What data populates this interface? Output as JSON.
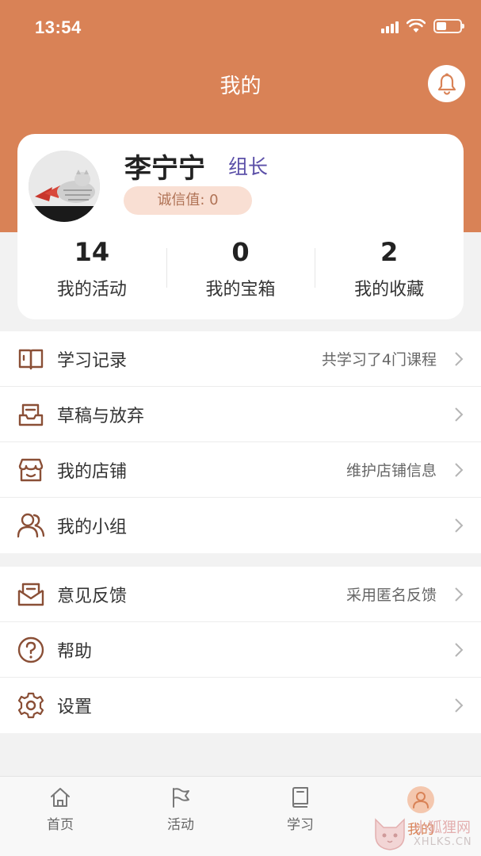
{
  "status_bar": {
    "time": "13:54"
  },
  "header": {
    "title": "我的",
    "bell_icon": "bell-icon"
  },
  "profile": {
    "name": "李宁宁",
    "role": "组长",
    "credit": "诚信值: 0",
    "stats": [
      {
        "value": "14",
        "label": "我的活动"
      },
      {
        "value": "0",
        "label": "我的宝箱"
      },
      {
        "value": "2",
        "label": "我的收藏"
      }
    ]
  },
  "menu_group_1": [
    {
      "icon": "book-open-icon",
      "label": "学习记录",
      "hint": "共学习了4门课程"
    },
    {
      "icon": "draft-tray-icon",
      "label": "草稿与放弃",
      "hint": ""
    },
    {
      "icon": "store-icon",
      "label": "我的店铺",
      "hint": "维护店铺信息"
    },
    {
      "icon": "users-icon",
      "label": "我的小组",
      "hint": ""
    }
  ],
  "menu_group_2": [
    {
      "icon": "feedback-mail-icon",
      "label": "意见反馈",
      "hint": "采用匿名反馈"
    },
    {
      "icon": "help-circle-icon",
      "label": "帮助",
      "hint": ""
    },
    {
      "icon": "gear-icon",
      "label": "设置",
      "hint": ""
    }
  ],
  "tabbar": [
    {
      "icon": "home-icon",
      "label": "首页",
      "active": false
    },
    {
      "icon": "flag-icon",
      "label": "活动",
      "active": false
    },
    {
      "icon": "book-icon",
      "label": "学习",
      "active": false
    },
    {
      "icon": "user-icon",
      "label": "我的",
      "active": true
    }
  ],
  "watermark": {
    "title": "小狐狸网",
    "url": "XHLKS.CN"
  },
  "colors": {
    "accent": "#d98256",
    "role": "#5b4fa8",
    "badge_bg": "#f9dfd3",
    "icon": "#8a4f36"
  }
}
